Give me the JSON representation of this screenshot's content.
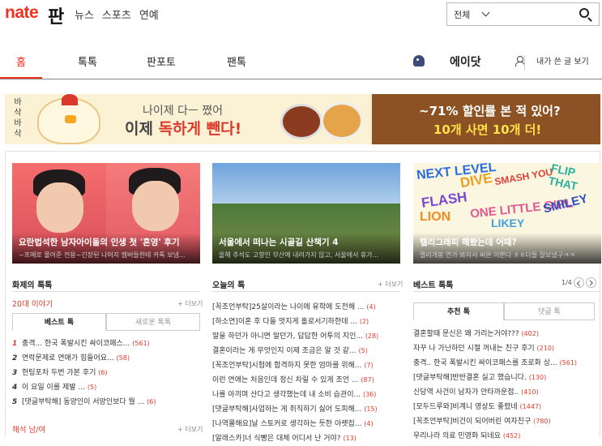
{
  "header": {
    "logo": "nate",
    "service": "판",
    "top_nav": [
      "뉴스",
      "스포츠",
      "연예"
    ],
    "search": {
      "scope": "전체"
    }
  },
  "main_nav": {
    "tabs": [
      "홈",
      "톡톡",
      "판포토",
      "팬톡"
    ],
    "active_index": 0,
    "eidat": "에이닷",
    "my_posts": "내가 쓴 글 보기"
  },
  "banner": {
    "vertical_text": "바삭바삭",
    "line1": "나이제 다ㅡ 쪘어",
    "line2_a": "이제 ",
    "line2_b": "독하게 뺀다!",
    "right_line1": "~71% 할인률 본 적 있어?",
    "right_line2": "10개 사면 10개 더!"
  },
  "cards": [
    {
      "title": "요란법석한 남자아이돌의 인생 첫 '혼영' 후기",
      "sub": "~프메로 풀어준 전용~긴장된 나머지 멤버들한테 카톡 보냄..."
    },
    {
      "title": "서울에서 떠나는 시골길 산책기 4",
      "sub": "올해 추석도 고향인 부산에 내려가지 않고, 서울에서 휴가..."
    },
    {
      "title": "캘리그래피 해봤는데 어때?",
      "sub": "캘리개봉 연가 봐지서 써본 이쁜다 ㅎㅎ다들 잘보냈구ㅋㅋ"
    }
  ],
  "card3_words": [
    "NEXT LEVEL",
    "DIVE",
    "SMASH YOU",
    "FLIP THAT",
    "FLASH",
    "LION",
    "ONE LITTLE GIRL",
    "LIKEY",
    "SMILEY"
  ],
  "col1": {
    "title": "화제의 톡톡",
    "sub_title": "20대 이야기",
    "more": "+ 더보기",
    "tabs": [
      "베스트 톡",
      "새로운 톡톡"
    ],
    "items": [
      {
        "rank": "1",
        "text": "충격... 한국 폭발시킨 싸이코패스...",
        "count": "(561)"
      },
      {
        "rank": "2",
        "text": "연락문제로 연애가 힘들어요...",
        "count": "(58)"
      },
      {
        "rank": "3",
        "text": "헌팅포차 두번 가본 후기",
        "count": "(6)"
      },
      {
        "rank": "4",
        "text": "이 요일 이를 제발 ...",
        "count": "(5)"
      },
      {
        "rank": "5",
        "text": "[댓글부탁해] 동양인이 서양인보다 뭘 ...",
        "count": "(6)"
      }
    ],
    "next_title": "해석 남/여",
    "next_more": "+ 더보기"
  },
  "col2": {
    "title": "오늘의 톡",
    "more": "+ 더보기",
    "items": [
      {
        "text": "[꼭조언부탁]25살이라는 나이에 유학에 도전해 ...",
        "count": "(4)"
      },
      {
        "text": "[하소연]이혼 후 다들 멋지게 홀로서기하한데 ...",
        "count": "(2)"
      },
      {
        "text": "말을 하던가 아니면 말던가, 답답한 어투의 지인...",
        "count": "(28)"
      },
      {
        "text": "결혼이라는 게 무엇인지 이제 조금은 알 것 같...",
        "count": "(5)"
      },
      {
        "text": "[꼭조언부탁]시험에 합격하지 못한 엄마를 위해...",
        "count": "(7)"
      },
      {
        "text": "이런 연애는 처음인데 정신 차릴 수 있게 조언 ...",
        "count": "(87)"
      },
      {
        "text": "나를 아끼며 산다고 생각했는데 내 소비 습관이...",
        "count": "(36)"
      },
      {
        "text": "[댓글부탁해]사업하는 게 취직하기 싫어 도피해...",
        "count": "(15)"
      },
      {
        "text": "[나역몰해요]날 스토커로 생각하는 듯한 아랫집...",
        "count": "(4)"
      },
      {
        "text": "[알래스카]너 식빵은 대체 어디서 난 거야?",
        "count": "(13)"
      }
    ]
  },
  "col3": {
    "title": "베스트 톡톡",
    "pager": "1/4",
    "tabs": [
      "추천 톡",
      "댓글 톡"
    ],
    "items": [
      {
        "text": "결혼할때 문신은 왜 가리는거야???",
        "count": "(402)"
      },
      {
        "text": "자꾸 나 가난하던 시절 꺼내는 친구 후기",
        "count": "(210)"
      },
      {
        "text": "충격.. 한국 폭발시킨 싸이코패스를 조로화 상...",
        "count": "(561)"
      },
      {
        "text": "[댓글부탁해]반반결혼 실고 했습니다.",
        "count": "(130)"
      },
      {
        "text": "신당역 사건이 남자가 안타까운점..",
        "count": "(410)"
      },
      {
        "text": "[모두드루와]비계니 영상도 좋렸네",
        "count": "(1447)"
      },
      {
        "text": "[꼭조언부탁]비건이 되어버린 여자친구",
        "count": "(780)"
      },
      {
        "text": "우리나라 의료 민영화 되네요",
        "count": "(452)"
      }
    ]
  }
}
